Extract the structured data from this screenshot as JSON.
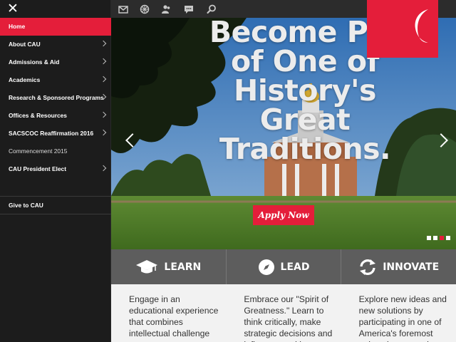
{
  "sidebar": {
    "close_icon": "close-icon",
    "items": [
      {
        "label": "Home"
      },
      {
        "label": "About CAU"
      },
      {
        "label": "Admissions & Aid"
      },
      {
        "label": "Academics"
      },
      {
        "label": "Research & Sponsored Programs"
      },
      {
        "label": "Offices & Resources"
      },
      {
        "label": "SACSCOC Reaffirmation 2016"
      },
      {
        "label": "Commencement 2015"
      },
      {
        "label": "CAU President Elect"
      }
    ],
    "give_label": "Give to CAU"
  },
  "toolbar": {
    "icons": [
      "mail-icon",
      "directory-icon",
      "people-icon",
      "chat-icon",
      "search-icon"
    ]
  },
  "hero": {
    "headline": [
      "Become Par",
      "of One of",
      "History's",
      "Great",
      "Traditions."
    ],
    "apply_label": "Apply Now",
    "slide_count": 4,
    "active_slide": 3
  },
  "features": [
    {
      "icon": "graduation-cap-icon",
      "label": "LEARN"
    },
    {
      "icon": "compass-icon",
      "label": "LEAD"
    },
    {
      "icon": "refresh-icon",
      "label": "INNOVATE"
    }
  ],
  "content": [
    "Engage in an educational experience that combines intellectual challenge",
    "Embrace our \"Spirit of Greatness.\" Learn to think critically, make strategic decisions and influence positive",
    "Explore new ideas and new solutions by participating in one of America's foremost university research"
  ],
  "colors": {
    "accent": "#e41e3a",
    "sidebar_bg": "#1c1c1c",
    "feature_bar": "#5d5d5d"
  }
}
